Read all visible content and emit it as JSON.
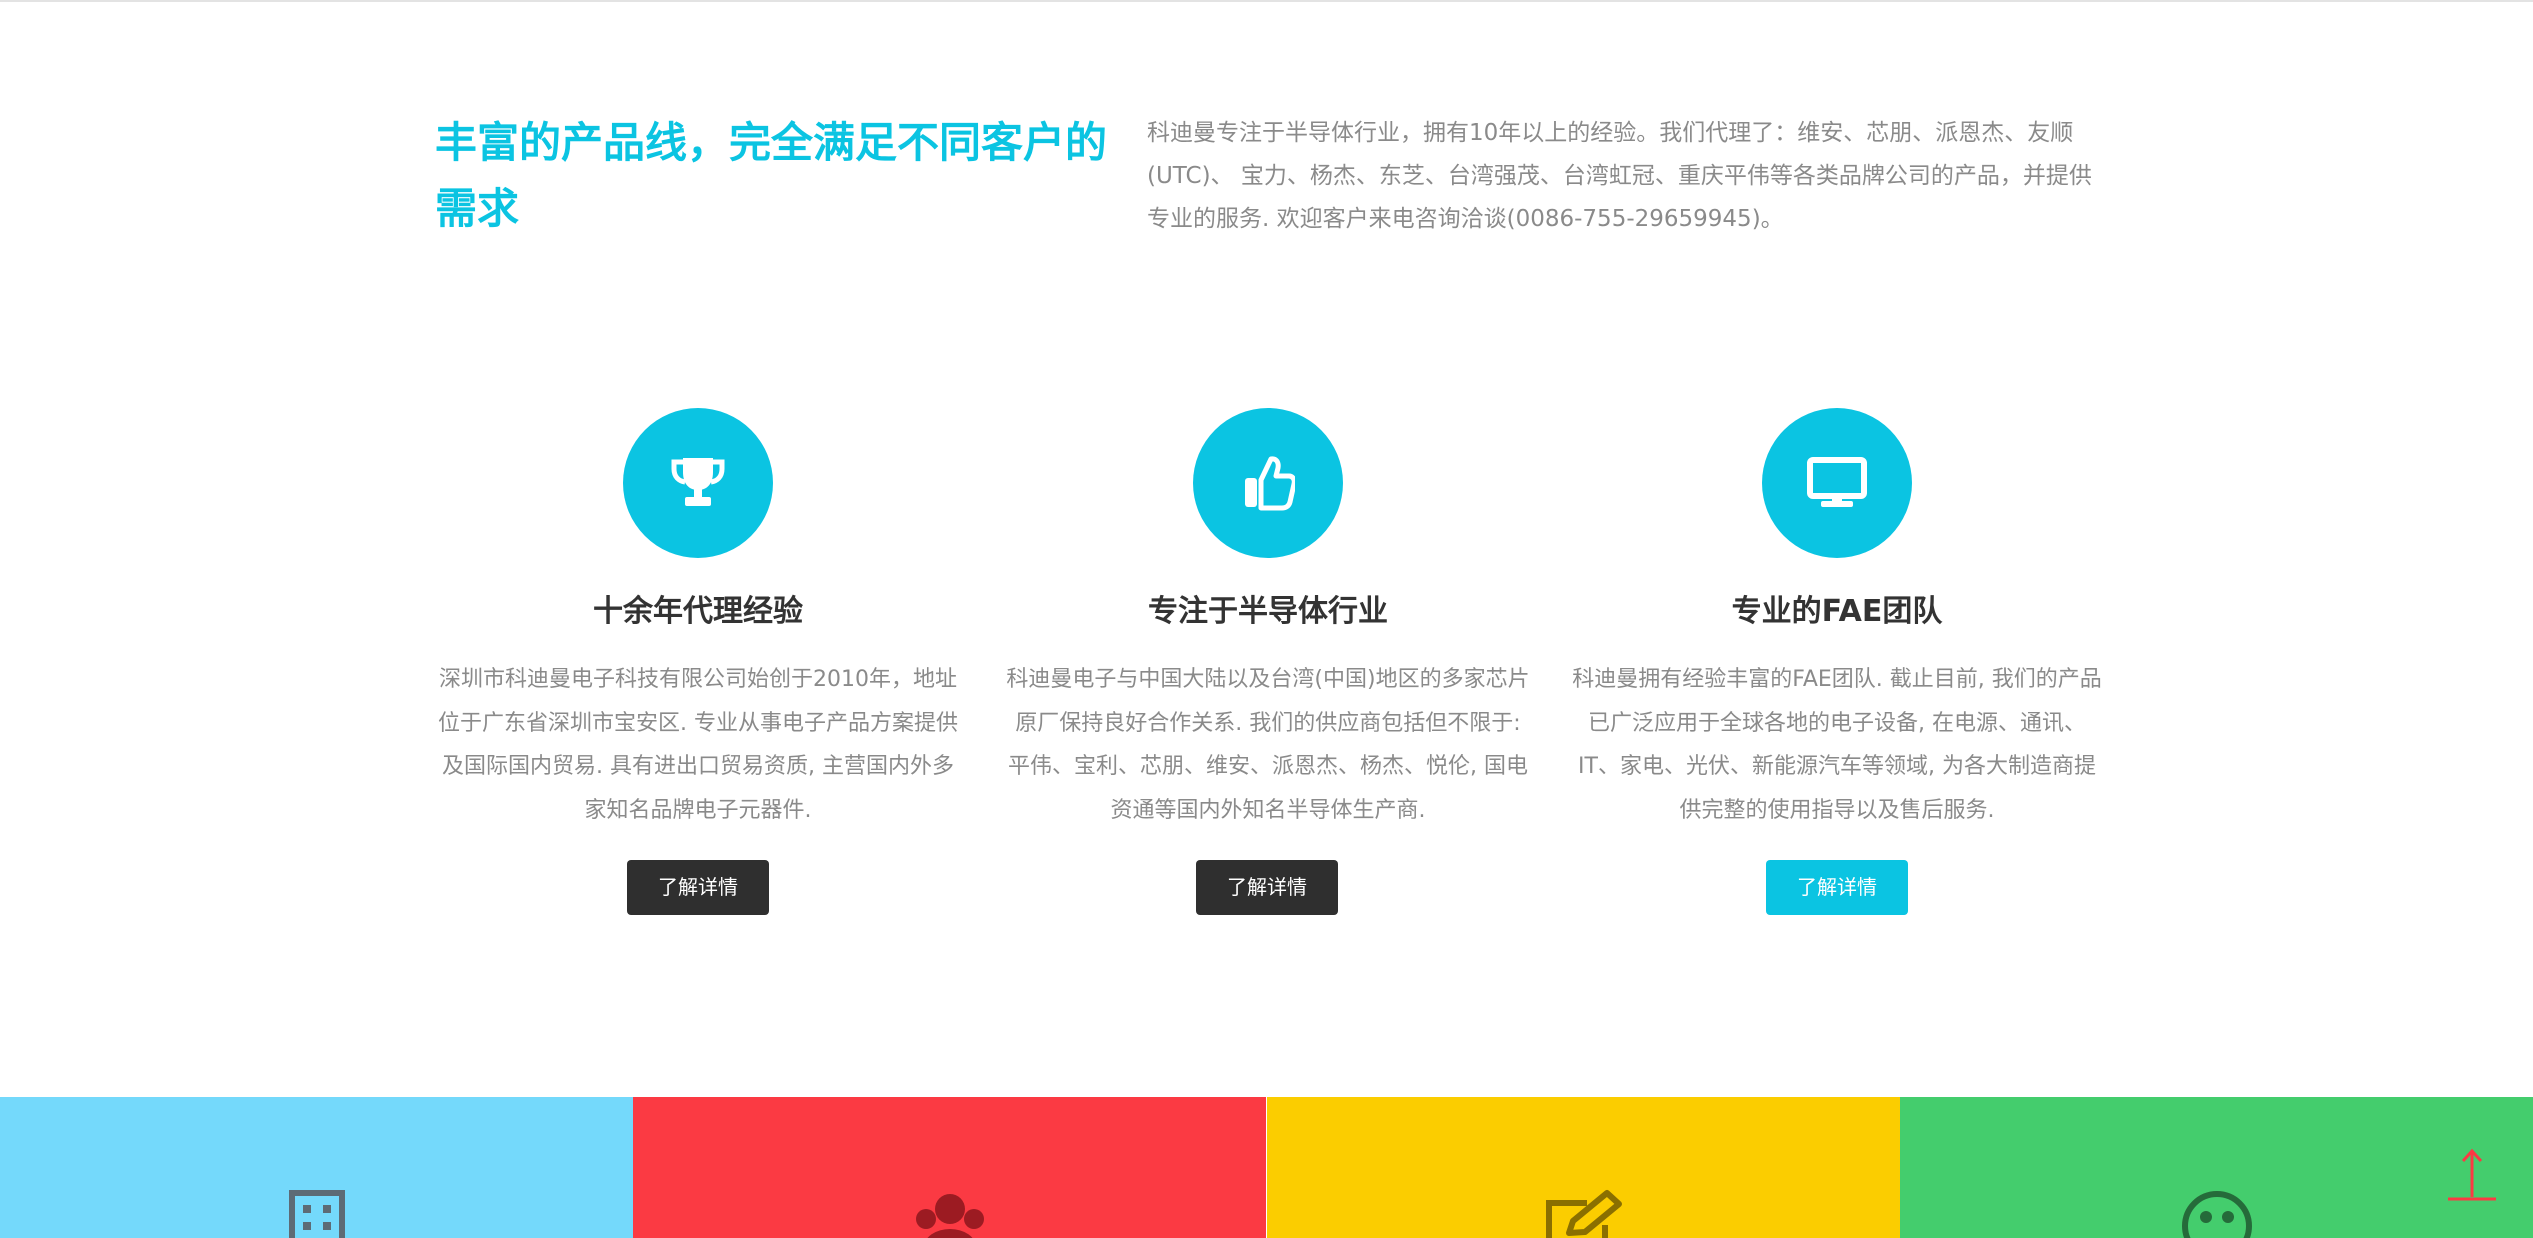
{
  "intro": {
    "title": "丰富的产品线，完全满足不同客户的需求",
    "text": "科迪曼专注于半导体行业，拥有10年以上的经验。我们代理了：维安、芯朋、派恩杰、友顺(UTC)、 宝力、杨杰、东芝、台湾强茂、台湾虹冠、重庆平伟等各类品牌公司的产品，并提供专业的服务. 欢迎客户来电咨询洽谈(0086-755-29659945)。"
  },
  "features": [
    {
      "icon": "trophy-icon",
      "title": "十余年代理经验",
      "text": "深圳市科迪曼电子科技有限公司始创于2010年，地址位于广东省深圳市宝安区. 专业从事电子产品方案提供及国际国内贸易. 具有进出口贸易资质, 主营国内外多家知名品牌电子元器件.",
      "button": "了解详情"
    },
    {
      "icon": "thumbs-up-icon",
      "title": "专注于半导体行业",
      "text": "科迪曼电子与中国大陆以及台湾(中国)地区的多家芯片原厂保持良好合作关系. 我们的供应商包括但不限于: 平伟、宝利、芯朋、维安、派恩杰、杨杰、悦伦, 国电资通等国内外知名半导体生产商.",
      "button": "了解详情"
    },
    {
      "icon": "monitor-icon",
      "title": "专业的FAE团队",
      "text": "科迪曼拥有经验丰富的FAE团队. 截止目前, 我们的产品已广泛应用于全球各地的电子设备, 在电源、通讯、IT、家电、光伏、新能源汽车等领域, 为各大制造商提供完整的使用指导以及售后服务.",
      "button": "了解详情"
    }
  ],
  "bands": [
    {
      "color": "#74d9fb",
      "icon": "building-icon"
    },
    {
      "color": "#fb3a43",
      "icon": "team-icon"
    },
    {
      "color": "#fbcd00",
      "icon": "edit-icon"
    },
    {
      "color": "#44cd6d",
      "icon": "smiley-icon"
    }
  ],
  "colors": {
    "accent": "#0bc4e2",
    "button_dark": "#2f2f2f",
    "heading": "#333333",
    "body_text": "#8a8a8a",
    "scroll_top": "#fb3a43"
  }
}
